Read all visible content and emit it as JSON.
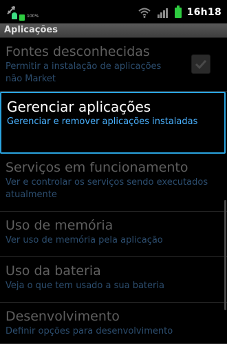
{
  "status_bar": {
    "time": "16h18",
    "battery_small_text": "100%",
    "icons": [
      "usb-debug-icon",
      "android-icon",
      "wifi-icon",
      "signal-icon",
      "battery-icon"
    ]
  },
  "title_bar": {
    "title": "Aplicações"
  },
  "items": [
    {
      "title": "Fontes desconhecidas",
      "summary": "Permitir a instalação de aplicações não Market",
      "state": "disabled",
      "checked": true
    },
    {
      "title": "Gerenciar aplicações",
      "summary": "Gerenciar e remover aplicações instaladas",
      "state": "selected"
    },
    {
      "title": "Serviços em funcionamento",
      "summary": "Ver e controlar os serviços sendo executados atualmente",
      "state": "disabled"
    },
    {
      "title": "Uso de memória",
      "summary": "Ver uso de memória pela aplicação",
      "state": "disabled"
    },
    {
      "title": "Uso da bateria",
      "summary": "Veja o que tem usado a sua bateria",
      "state": "disabled"
    },
    {
      "title": "Desenvolvimento",
      "summary": "Definir opções para desenvolvimento",
      "state": "disabled"
    }
  ],
  "colors": {
    "accent": "#2aa4e0",
    "summary_selected": "#4ab2ff",
    "summary_disabled": "#2c4d6e",
    "battery": "#2ecc40"
  }
}
